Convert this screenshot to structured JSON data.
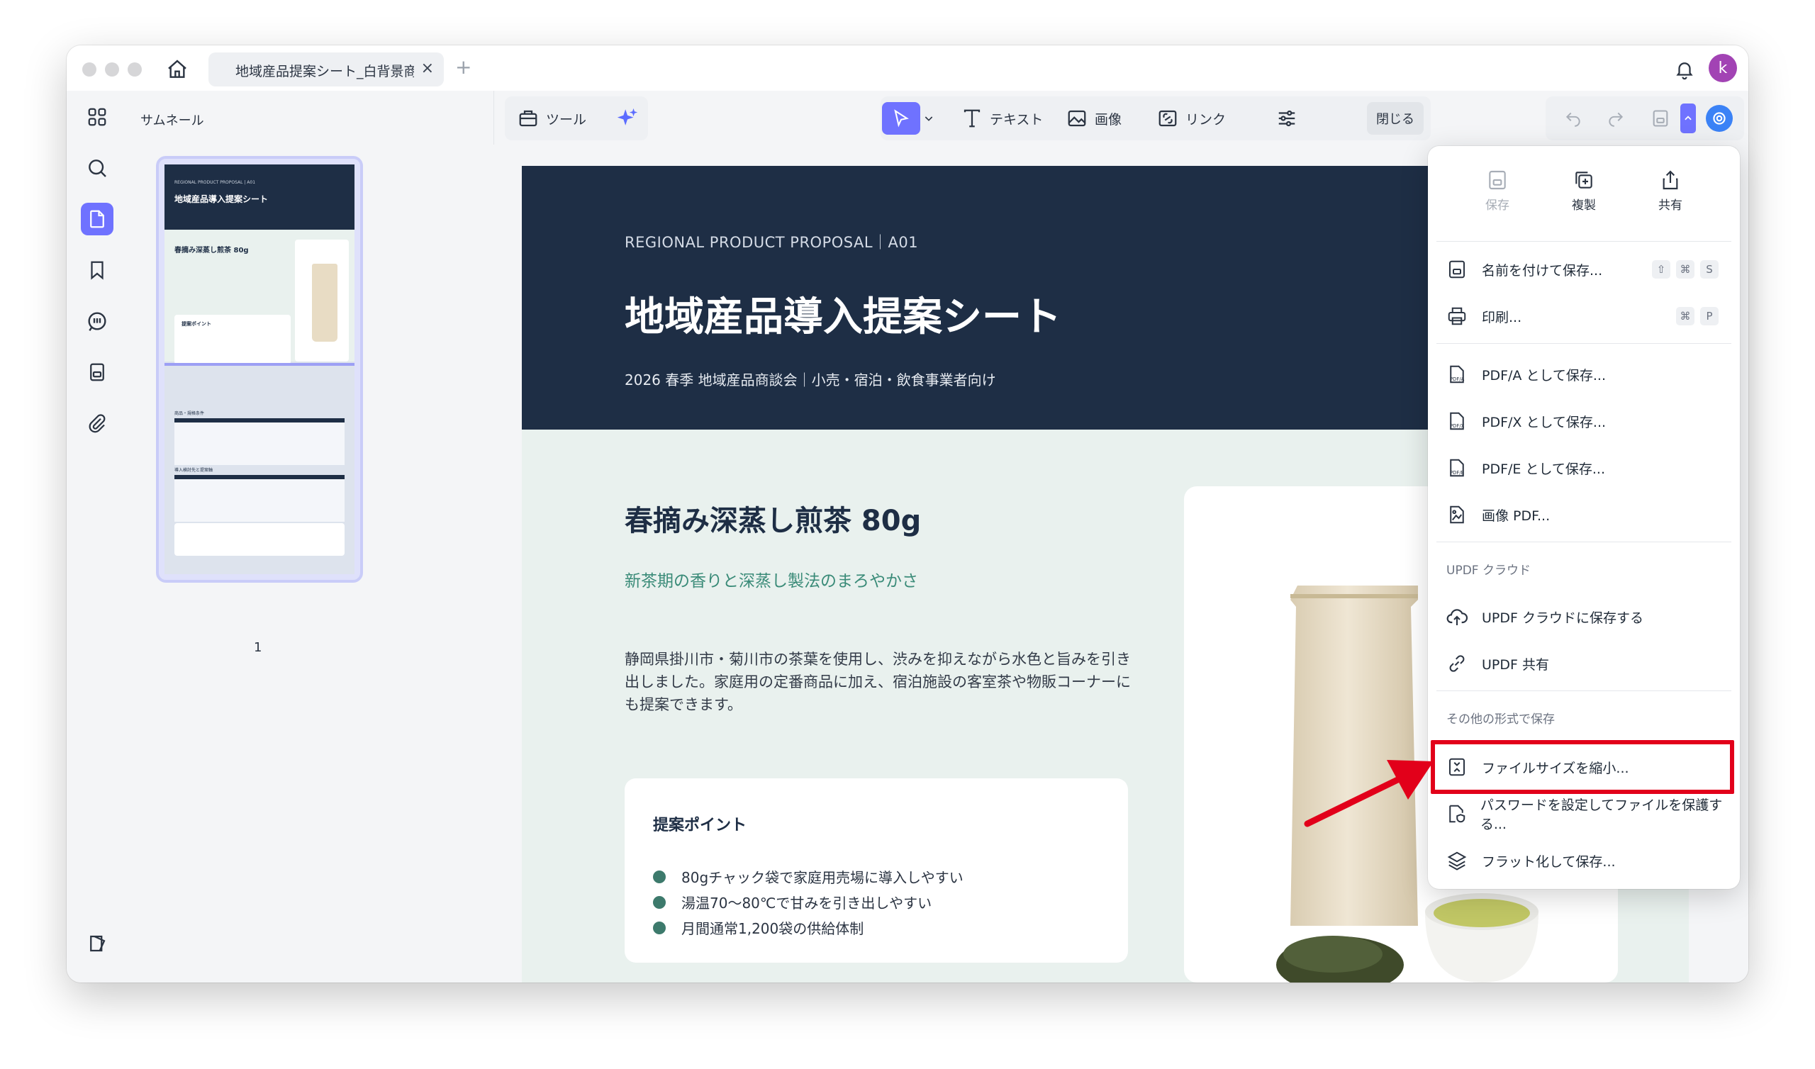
{
  "window": {
    "tab_title": "地域産品提案シート_白背景商品",
    "tab_close": "×",
    "tab_add": "+",
    "avatar_initial": "k"
  },
  "sidebar": {
    "panel_title": "サムネール",
    "items": [
      {
        "name": "thumbnails-grid-icon"
      },
      {
        "name": "search-icon"
      },
      {
        "name": "page-icon",
        "active": true
      },
      {
        "name": "bookmark-icon"
      },
      {
        "name": "comment-icon"
      },
      {
        "name": "attachment-list-icon"
      },
      {
        "name": "paperclip-icon"
      },
      {
        "name": "layers-icon"
      }
    ],
    "thumbnail_page_number": "1"
  },
  "toolbar": {
    "tools_label": "ツール",
    "text_label": "テキスト",
    "image_label": "画像",
    "link_label": "リンク",
    "close_label": "閉じる"
  },
  "thumbnail_text": {
    "kicker": "REGIONAL PRODUCT PROPOSAL | A01",
    "title": "地域産品導入提案シート",
    "product": "春摘み深蒸し煎茶 80g",
    "points_title": "提案ポイント",
    "section_spec": "商品・規格条件",
    "section_partners": "導入検討先と提案軸"
  },
  "document": {
    "kicker": "REGIONAL PRODUCT PROPOSAL｜A01",
    "title": "地域産品導入提案シート",
    "subtitle": "2026 春季 地域産品商談会｜小売・宿泊・飲食事業者向け",
    "product_name": "春摘み深蒸し煎茶 80g",
    "product_tagline": "新茶期の香りと深蒸し製法のまろやかさ",
    "product_description": "静岡県掛川市・菊川市の茶葉を使用し、渋みを抑えながら水色と旨みを引き出しました。家庭用の定番商品に加え、宿泊施設の客室茶や物販コーナーにも提案できます。",
    "points_title": "提案ポイント",
    "points": [
      "80gチャック袋で家庭用売場に導入しやすい",
      "湯温70〜80℃で甘みを引き出しやすい",
      "月間通常1,200袋の供給体制"
    ]
  },
  "menu": {
    "top_actions": [
      {
        "label": "保存",
        "icon": "save-icon",
        "disabled": true
      },
      {
        "label": "複製",
        "icon": "duplicate-icon",
        "disabled": false
      },
      {
        "label": "共有",
        "icon": "share-icon",
        "disabled": false
      }
    ],
    "save_as": {
      "label": "名前を付けて保存...",
      "shortcut": [
        "⇧",
        "⌘",
        "S"
      ]
    },
    "print": {
      "label": "印刷...",
      "shortcut": [
        "⌘",
        "P"
      ]
    },
    "pdfa": "PDF/A として保存...",
    "pdfx": "PDF/X として保存...",
    "pdfe": "PDF/E として保存...",
    "image_pdf": "画像 PDF...",
    "cloud_section": "UPDF クラウド",
    "cloud_save": "UPDF クラウドに保存する",
    "updf_share": "UPDF 共有",
    "other_section": "その他の形式で保存",
    "reduce_size": "ファイルサイズを縮小...",
    "password": "パスワードを設定してファイルを保護する...",
    "flatten": "フラット化して保存...",
    "pdfa_badge": "PDF/A",
    "pdfx_badge": "PDF/X",
    "pdfe_badge": "PDF/E"
  },
  "colors": {
    "accent": "#6f72ff",
    "header_navy": "#1e2e45",
    "highlight_red": "#e2001a",
    "tagline_green": "#3a8b78"
  }
}
